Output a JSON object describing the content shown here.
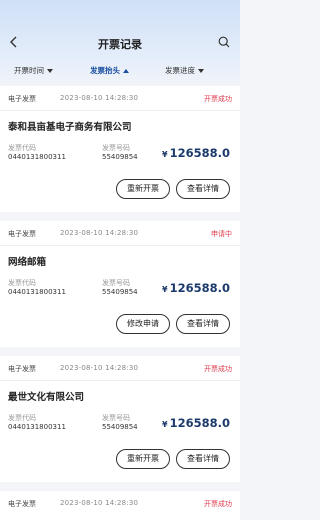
{
  "header": {
    "title": "开票记录",
    "back_icon": "chevron-left-icon",
    "search_icon": "search-icon"
  },
  "filters": [
    {
      "label": "开票时间",
      "state": "down"
    },
    {
      "label": "发票抬头",
      "state": "up",
      "active": true
    },
    {
      "label": "发票进度",
      "state": "down"
    }
  ],
  "colors": {
    "accent": "#1a4fa0",
    "status_red": "#e0394b",
    "amount": "#1b3a6b"
  },
  "records": [
    {
      "type": "电子发票",
      "time": "2023-08-10 14:28:30",
      "status": "开票成功",
      "company": "泰和县亩基电子商务有限公司",
      "code_label": "发票代码",
      "code": "0440131800311",
      "number_label": "发票号码",
      "number": "55409854",
      "amount": "126588.0",
      "currency": "¥",
      "buttons": [
        "重新开票",
        "查看详情"
      ]
    },
    {
      "type": "电子发票",
      "time": "2023-08-10 14:28:30",
      "status": "申请中",
      "company": "网络邮箱",
      "code_label": "发票代码",
      "code": "0440131800311",
      "number_label": "发票号码",
      "number": "55409854",
      "amount": "126588.0",
      "currency": "¥",
      "buttons": [
        "修改申请",
        "查看详情"
      ]
    },
    {
      "type": "电子发票",
      "time": "2023-08-10 14:28:30",
      "status": "开票成功",
      "company": "最世文化有限公司",
      "code_label": "发票代码",
      "code": "0440131800311",
      "number_label": "发票号码",
      "number": "55409854",
      "amount": "126588.0",
      "currency": "¥",
      "buttons": [
        "重新开票",
        "查看详情"
      ]
    },
    {
      "type": "电子发票",
      "time": "2023-08-10 14:28:30",
      "status": "开票成功"
    }
  ]
}
